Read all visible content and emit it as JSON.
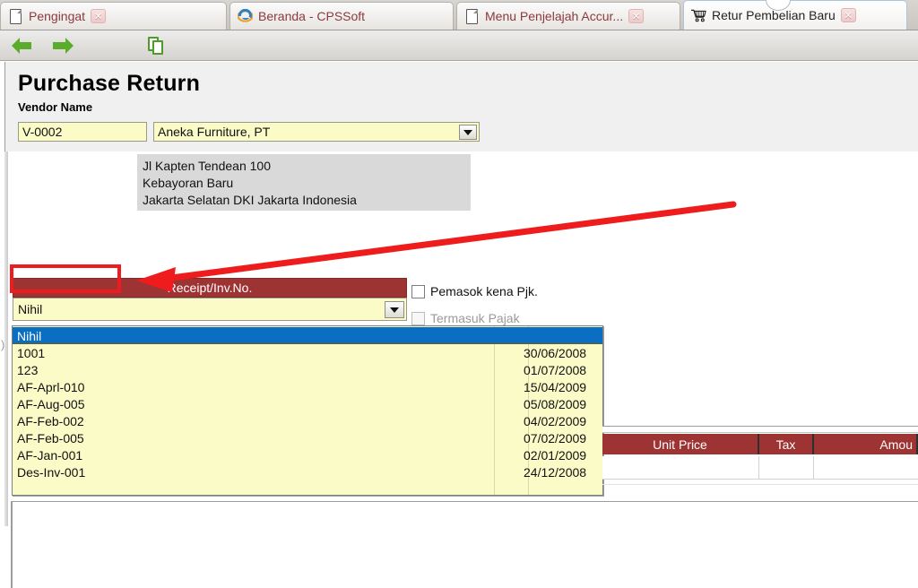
{
  "window": {
    "tabs": [
      {
        "label": "Pengingat",
        "icon": "page-icon",
        "close": "✕",
        "active": false
      },
      {
        "label": "Beranda - CPSSoft",
        "icon": "ie-icon",
        "close": "",
        "active": false
      },
      {
        "label": "Menu Penjelajah Accur...",
        "icon": "page-icon",
        "close": "✕",
        "active": false
      },
      {
        "label": "Retur Pembelian Baru",
        "icon": "cart-icon",
        "close": "✕",
        "active": true
      }
    ]
  },
  "toolbar": {
    "back": "back-arrow",
    "forward": "forward-arrow",
    "copy": "copy-icon"
  },
  "form": {
    "title": "Purchase Return",
    "vendor_label": "Vendor Name",
    "vendor_code": "V-0002",
    "vendor_name": "Aneka Furniture, PT",
    "address_lines": [
      "Jl Kapten Tendean 100",
      "Kebayoran Baru",
      "Jakarta Selatan DKI Jakarta Indonesia"
    ]
  },
  "receipt": {
    "header": "Receipt/Inv.No.",
    "value": "Nihil",
    "checkbox_taxable": "Pemasok kena Pjk.",
    "checkbox_include_tax": "Termasuk Pajak"
  },
  "dropdown": {
    "rows": [
      {
        "no": "Nihil",
        "mid": "",
        "date": "",
        "selected": true
      },
      {
        "no": "1001",
        "mid": "",
        "date": "30/06/2008",
        "selected": false
      },
      {
        "no": "123",
        "mid": "",
        "date": "01/07/2008",
        "selected": false
      },
      {
        "no": "AF-Aprl-010",
        "mid": "",
        "date": "15/04/2009",
        "selected": false
      },
      {
        "no": "AF-Aug-005",
        "mid": "",
        "date": "05/08/2009",
        "selected": false
      },
      {
        "no": "AF-Feb-002",
        "mid": "",
        "date": "04/02/2009",
        "selected": false
      },
      {
        "no": "AF-Feb-005",
        "mid": "",
        "date": "07/02/2009",
        "selected": false
      },
      {
        "no": "AF-Jan-001",
        "mid": "",
        "date": "02/01/2009",
        "selected": false
      },
      {
        "no": "Des-Inv-001",
        "mid": "",
        "date": "24/12/2008",
        "selected": false
      }
    ]
  },
  "grid": {
    "headers": [
      "Unit Price",
      "Tax",
      "Amou"
    ],
    "row": [
      "",
      "",
      ""
    ]
  },
  "annotation": {
    "arrow_color": "#ee1c1c",
    "highlight_color": "#ee1c1c",
    "edge_glyph": ")"
  },
  "colors": {
    "header_red": "#9e3334",
    "field_yellow": "#fbfbc8",
    "selection_blue": "#0a6fc2",
    "tab_text": "#8b3a3f"
  }
}
